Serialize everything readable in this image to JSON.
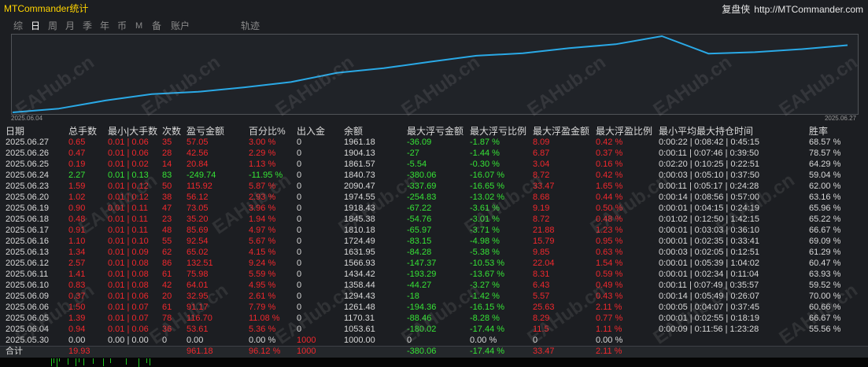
{
  "header": {
    "title": "MTCommander统计",
    "brand": "复盘侠",
    "url": "http://MTCommander.com"
  },
  "tabs": [
    {
      "label": "综"
    },
    {
      "label": "日",
      "active": true
    },
    {
      "label": "周"
    },
    {
      "label": "月"
    },
    {
      "label": "季"
    },
    {
      "label": "年"
    },
    {
      "label": "币"
    },
    {
      "label": "M"
    },
    {
      "label": "备"
    },
    {
      "label": "账户"
    },
    {
      "label": "轨迹"
    }
  ],
  "chart_data": {
    "type": "line",
    "x": [
      "2025.05.30",
      "2025.06.04",
      "2025.06.05",
      "2025.06.06",
      "2025.06.09",
      "2025.06.10",
      "2025.06.11",
      "2025.06.12",
      "2025.06.13",
      "2025.06.16",
      "2025.06.17",
      "2025.06.18",
      "2025.06.19",
      "2025.06.20",
      "2025.06.23",
      "2025.06.24",
      "2025.06.25",
      "2025.06.26",
      "2025.06.27"
    ],
    "values": [
      1000.0,
      1053.61,
      1170.31,
      1261.48,
      1294.43,
      1358.44,
      1434.42,
      1566.93,
      1631.95,
      1724.49,
      1810.18,
      1845.38,
      1918.43,
      1974.55,
      2090.47,
      1840.73,
      1861.57,
      1904.13,
      1961.18
    ],
    "x_tick_labels": [
      "2025.06.04",
      "2025.06.27"
    ],
    "title": "",
    "xlabel": "",
    "ylabel": "",
    "ylim": [
      1000.0,
      2090.47
    ],
    "grid": false,
    "legend": "none",
    "color": "#2aa9e6"
  },
  "table": {
    "columns": [
      "日期",
      "总手数",
      "最小|大手数",
      "次数",
      "盈亏金额",
      "百分比%",
      "出入金",
      "余额",
      "最大浮亏金额",
      "最大浮亏比例",
      "最大浮盈金额",
      "最大浮盈比例",
      "最小平均最大持仓时间",
      "胜率"
    ],
    "rows": [
      [
        "2025.06.27",
        "0.65",
        "0.01 | 0.06",
        "35",
        "57.05",
        "3.00 %",
        "0",
        "1961.18",
        "-36.09",
        "-1.87 %",
        "8.09",
        "0.42 %",
        "0:00:22 | 0:08:42 | 0:45:15",
        "68.57 %"
      ],
      [
        "2025.06.26",
        "0.47",
        "0.01 | 0.06",
        "28",
        "42.56",
        "2.29 %",
        "0",
        "1904.13",
        "-27",
        "-1.44 %",
        "6.87",
        "0.37 %",
        "0:00:11 | 0:07:46 | 0:39:50",
        "78.57 %"
      ],
      [
        "2025.06.25",
        "0.19",
        "0.01 | 0.02",
        "14",
        "20.84",
        "1.13 %",
        "0",
        "1861.57",
        "-5.54",
        "-0.30 %",
        "3.04",
        "0.16 %",
        "0:02:20 | 0:10:25 | 0:22:51",
        "64.29 %"
      ],
      [
        "2025.06.24",
        "2.27",
        "0.01 | 0.13",
        "83",
        "-249.74",
        "-11.95 %",
        "0",
        "1840.73",
        "-380.06",
        "-16.07 %",
        "8.72",
        "0.42 %",
        "0:00:03 | 0:05:10 | 0:37:50",
        "59.04 %"
      ],
      [
        "2025.06.23",
        "1.59",
        "0.01 | 0.12",
        "50",
        "115.92",
        "5.87 %",
        "0",
        "2090.47",
        "-337.69",
        "-16.65 %",
        "33.47",
        "1.65 %",
        "0:00:11 | 0:05:17 | 0:24:28",
        "62.00 %"
      ],
      [
        "2025.06.20",
        "1.02",
        "0.01 | 0.12",
        "38",
        "56.12",
        "2.93 %",
        "0",
        "1974.55",
        "-254.83",
        "-13.02 %",
        "8.68",
        "0.44 %",
        "0:00:14 | 0:08:56 | 0:57:00",
        "63.16 %"
      ],
      [
        "2025.06.19",
        "0.90",
        "0.01 | 0.11",
        "47",
        "73.05",
        "3.96 %",
        "0",
        "1918.43",
        "-67.22",
        "-3.61 %",
        "9.19",
        "0.50 %",
        "0:00:01 | 0:04:15 | 0:24:19",
        "65.96 %"
      ],
      [
        "2025.06.18",
        "0.48",
        "0.01 | 0.11",
        "23",
        "35.20",
        "1.94 %",
        "0",
        "1845.38",
        "-54.76",
        "-3.01 %",
        "8.72",
        "0.48 %",
        "0:01:02 | 0:12:50 | 1:42:15",
        "65.22 %"
      ],
      [
        "2025.06.17",
        "0.91",
        "0.01 | 0.11",
        "48",
        "85.69",
        "4.97 %",
        "0",
        "1810.18",
        "-65.97",
        "-3.71 %",
        "21.88",
        "1.23 %",
        "0:00:01 | 0:03:03 | 0:36:10",
        "66.67 %"
      ],
      [
        "2025.06.16",
        "1.10",
        "0.01 | 0.10",
        "55",
        "92.54",
        "5.67 %",
        "0",
        "1724.49",
        "-83.15",
        "-4.98 %",
        "15.79",
        "0.95 %",
        "0:00:01 | 0:02:35 | 0:33:41",
        "69.09 %"
      ],
      [
        "2025.06.13",
        "1.34",
        "0.01 | 0.09",
        "62",
        "65.02",
        "4.15 %",
        "0",
        "1631.95",
        "-84.28",
        "-5.38 %",
        "9.85",
        "0.63 %",
        "0:00:03 | 0:02:05 | 0:12:51",
        "61.29 %"
      ],
      [
        "2025.06.12",
        "2.57",
        "0.01 | 0.08",
        "86",
        "132.51",
        "9.24 %",
        "0",
        "1566.93",
        "-147.37",
        "-10.53 %",
        "22.04",
        "1.54 %",
        "0:00:01 | 0:05:39 | 1:04:02",
        "60.47 %"
      ],
      [
        "2025.06.11",
        "1.41",
        "0.01 | 0.08",
        "61",
        "75.98",
        "5.59 %",
        "0",
        "1434.42",
        "-193.29",
        "-13.67 %",
        "8.31",
        "0.59 %",
        "0:00:01 | 0:02:34 | 0:11:04",
        "63.93 %"
      ],
      [
        "2025.06.10",
        "0.83",
        "0.01 | 0.08",
        "42",
        "64.01",
        "4.95 %",
        "0",
        "1358.44",
        "-44.27",
        "-3.27 %",
        "6.43",
        "0.49 %",
        "0:00:11 | 0:07:49 | 0:35:57",
        "59.52 %"
      ],
      [
        "2025.06.09",
        "0.37",
        "0.01 | 0.06",
        "20",
        "32.95",
        "2.61 %",
        "0",
        "1294.43",
        "-18",
        "-1.42 %",
        "5.57",
        "0.43 %",
        "0:00:14 | 0:05:49 | 0:26:07",
        "70.00 %"
      ],
      [
        "2025.06.06",
        "1.50",
        "0.01 | 0.07",
        "61",
        "91.17",
        "7.79 %",
        "0",
        "1261.48",
        "-194.36",
        "-16.15 %",
        "25.63",
        "2.11 %",
        "0:00:05 | 0:04:07 | 0:37:45",
        "60.66 %"
      ],
      [
        "2025.06.05",
        "1.39",
        "0.01 | 0.07",
        "78",
        "116.70",
        "11.08 %",
        "0",
        "1170.31",
        "-88.46",
        "-8.28 %",
        "8.29",
        "0.77 %",
        "0:00:01 | 0:02:55 | 0:18:19",
        "66.67 %"
      ],
      [
        "2025.06.04",
        "0.94",
        "0.01 | 0.06",
        "36",
        "53.61",
        "5.36 %",
        "0",
        "1053.61",
        "-180.02",
        "-17.44 %",
        "11.5",
        "1.11 %",
        "0:00:09 | 0:11:56 | 1:23:28",
        "55.56 %"
      ],
      [
        "2025.05.30",
        "0.00",
        "0.00 | 0.00",
        "0",
        "0.00",
        "0.00 %",
        "1000",
        "1000.00",
        "0",
        "0.00 %",
        "0",
        "0.00 %",
        "",
        ""
      ]
    ],
    "total": [
      "合计",
      "19.93",
      "",
      "",
      "961.18",
      "96.12 %",
      "1000",
      "",
      "-380.06",
      "-17.44 %",
      "33.47",
      "2.11 %",
      "",
      ""
    ]
  },
  "colors": {
    "title": "#ffd400",
    "text": "#d9d9d9",
    "tab": "#8a8a8a",
    "tab_active": "#ffffff",
    "profit": "#f0282d",
    "loss": "#36e336",
    "line": "#2aa9e6",
    "histogram": "#1fc41f"
  },
  "watermark": "EAHub.cn"
}
